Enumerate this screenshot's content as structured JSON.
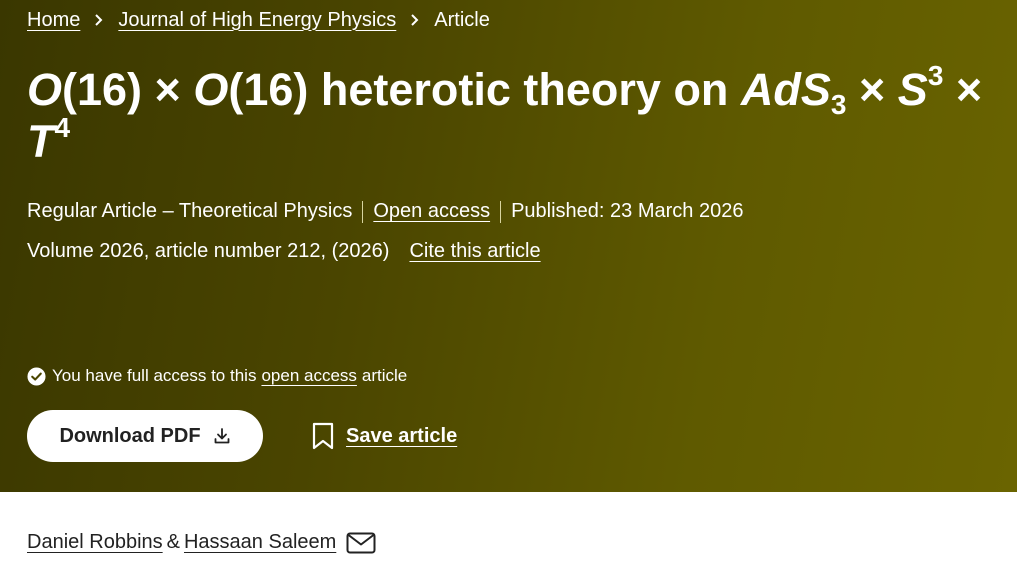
{
  "breadcrumb": {
    "home": "Home",
    "journal": "Journal of High Energy Physics",
    "current": "Article"
  },
  "title": {
    "o1": "O",
    "p1": "(16) × ",
    "o2": "O",
    "p2": "(16) heterotic theory on ",
    "ads": "AdS",
    "ads_sub": "3",
    "x1": " × ",
    "s": "S",
    "s_sup": "3",
    "x2": " × ",
    "t": "T",
    "t_sup": "4"
  },
  "meta": {
    "type": "Regular Article – Theoretical Physics",
    "open_access": "Open access",
    "published": "Published: 23 March 2026",
    "volume": "Volume 2026, article number 212, (2026)",
    "cite": "Cite this article"
  },
  "access": {
    "prefix": "You have full access to this",
    "link": "open access",
    "suffix": "article"
  },
  "actions": {
    "download": "Download PDF",
    "save": "Save article"
  },
  "authors": {
    "a1": "Daniel Robbins",
    "amp": "&",
    "a2": "Hassaan Saleem"
  },
  "colors": {
    "hero_dark": "#3a3700",
    "hero_light": "#6a6400",
    "text_on_hero": "#ffffff",
    "body_text": "#222222"
  },
  "icons": [
    "chevron-right-icon",
    "check-circle-icon",
    "download-icon",
    "bookmark-icon",
    "mail-icon"
  ]
}
